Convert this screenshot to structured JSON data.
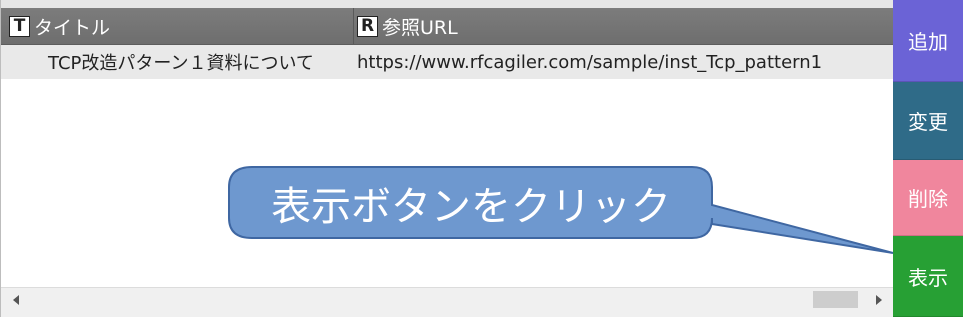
{
  "grid": {
    "columns": [
      {
        "badge": "T",
        "label": "タイトル"
      },
      {
        "badge": "R",
        "label": "参照URL"
      }
    ],
    "rows": [
      {
        "title": "TCP改造パターン１資料について",
        "url": "https://www.rfcagiler.com/sample/inst_Tcp_pattern1"
      }
    ]
  },
  "buttons": {
    "add": "追加",
    "change": "変更",
    "delete": "削除",
    "show": "表示"
  },
  "callout": {
    "text": "表示ボタンをクリック"
  },
  "colors": {
    "header_bg": "#757575",
    "row_bg": "#e9e9e9",
    "add_button": "#6b63d6",
    "change_button": "#2f6b88",
    "delete_button": "#f0869d",
    "show_button": "#27a034",
    "callout_fill": "#6e98cf",
    "callout_border": "#3f67a2"
  },
  "icons": {
    "scroll_left": "left-arrow-icon",
    "scroll_right": "right-arrow-icon"
  }
}
